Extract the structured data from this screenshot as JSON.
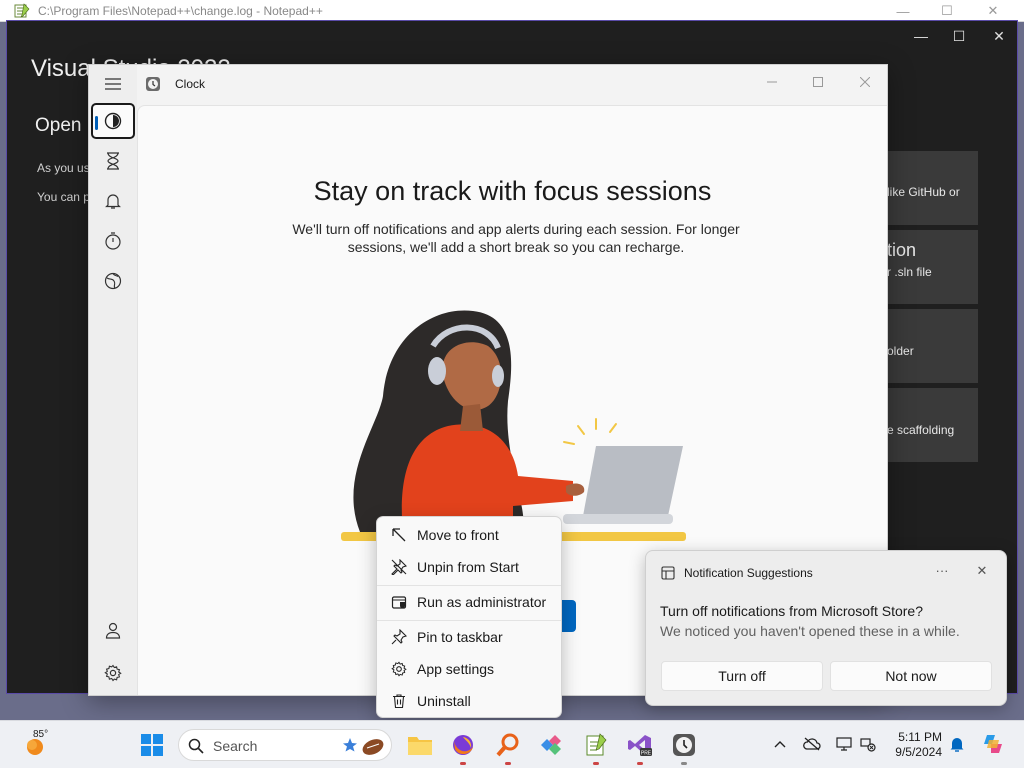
{
  "notepad": {
    "title": "C:\\Program Files\\Notepad++\\change.log - Notepad++",
    "minimize": "—",
    "maximize": "☐",
    "close": "✕"
  },
  "visual_studio": {
    "title": "Visual Studio 2022",
    "open_heading": "Open r",
    "line1": "As you us",
    "line2": "You can p",
    "minimize": "—",
    "maximize": "☐",
    "close": "✕",
    "cards": [
      {
        "text": "like GitHub or"
      },
      {
        "title": "tion",
        "text": "r .sln file"
      },
      {
        "text": "older"
      },
      {
        "text": "e scaffolding"
      }
    ]
  },
  "clock": {
    "title": "Clock",
    "nav": [
      "focus-sessions",
      "timer",
      "alarm",
      "stopwatch",
      "world-clock"
    ],
    "heading": "Stay on track with focus sessions",
    "subtext": "We'll turn off notifications and app alerts during each session. For longer sessions, we'll add a short break so you can recharge."
  },
  "context_menu": {
    "items": [
      {
        "label": "Move to front",
        "icon": "move-to-front-icon"
      },
      {
        "label": "Unpin from Start",
        "icon": "unpin-icon"
      },
      {
        "label": "Run as administrator",
        "icon": "shield-icon"
      },
      {
        "label": "Pin to taskbar",
        "icon": "pin-icon"
      },
      {
        "label": "App settings",
        "icon": "gear-icon"
      },
      {
        "label": "Uninstall",
        "icon": "trash-icon"
      }
    ]
  },
  "notification": {
    "header": "Notification Suggestions",
    "more": "···",
    "close": "✕",
    "question": "Turn off notifications from Microsoft Store?",
    "body": "We noticed you haven't opened these in a while.",
    "turn_off": "Turn off",
    "not_now": "Not now"
  },
  "taskbar": {
    "weather_temp": "85°",
    "search_placeholder": "Search",
    "time": "5:11 PM",
    "date": "9/5/2024",
    "accent": "#0067c0"
  }
}
